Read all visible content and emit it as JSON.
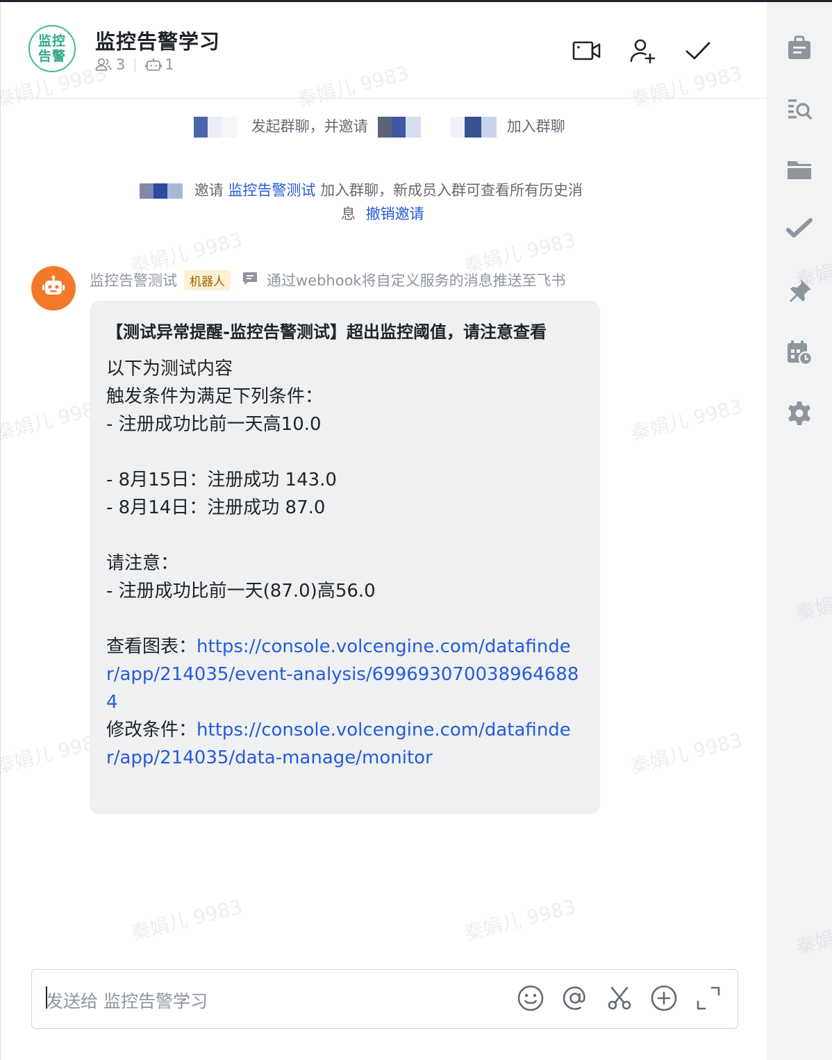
{
  "chat": {
    "avatar_text_line1": "监控",
    "avatar_text_line2": "告警",
    "title": "监控告警学习",
    "member_count": "3",
    "bot_count": "1"
  },
  "system_messages": {
    "created_text": "发起群聊，并邀请",
    "created_suffix": "加入群聊",
    "invite_prefix": "邀请",
    "invite_link": "监控告警测试",
    "invite_text": "加入群聊，新成员入群可查看所有历史消",
    "invite_text_cont": "息",
    "revoke_link": "撤销邀请"
  },
  "bot": {
    "name": "监控告警测试",
    "badge": "机器人",
    "description": "通过webhook将自定义服务的消息推送至飞书"
  },
  "message": {
    "title": "【测试异常提醒-监控告警测试】超出监控阈值，请注意查看",
    "line1": "以下为测试内容",
    "line2": "触发条件为满足下列条件：",
    "line3": "- 注册成功比前一天高10.0",
    "line4": "- 8月15日：注册成功 143.0",
    "line5": "- 8月14日：注册成功 87.0",
    "line6": "请注意：",
    "line7": "- 注册成功比前一天(87.0)高56.0",
    "chart_label": "查看图表：",
    "chart_url": "https://console.volcengine.com/datafinder/app/214035/event-analysis/6996930700389646884",
    "edit_label": "修改条件：",
    "edit_url": "https://console.volcengine.com/datafinder/app/214035/data-manage/monitor"
  },
  "input": {
    "placeholder": "发送给 监控告警学习"
  },
  "watermark": "秦娟儿 9983",
  "colors": {
    "accent_link": "#245bdb",
    "bot_avatar": "#f27a2a",
    "group_avatar": "#3fb79a",
    "bubble_bg": "#eff0f1"
  },
  "icons": {
    "header": [
      "video-call-icon",
      "add-member-icon",
      "check-icon"
    ],
    "sidebar": [
      "announcement-icon",
      "search-history-icon",
      "folder-icon",
      "task-icon",
      "pin-icon",
      "calendar-icon",
      "settings-icon"
    ],
    "toolbar": [
      "emoji-icon",
      "mention-icon",
      "scissors-icon",
      "plus-icon",
      "expand-icon"
    ]
  }
}
